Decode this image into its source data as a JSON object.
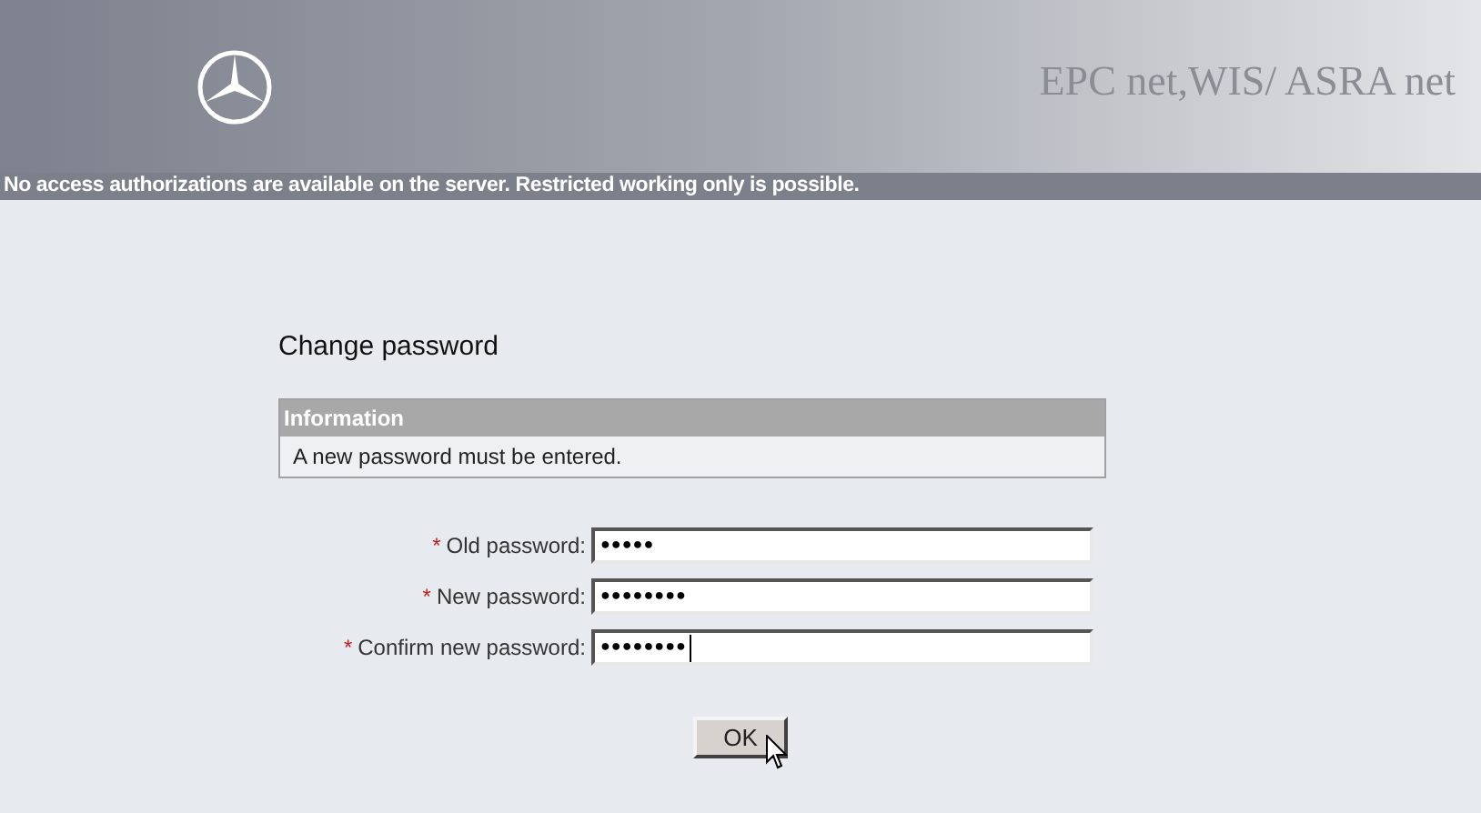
{
  "header": {
    "title": "EPC net,WIS/ ASRA net"
  },
  "notice": "No access authorizations are available on the server. Restricted working only is possible.",
  "form": {
    "title": "Change password",
    "info": {
      "heading": "Information",
      "message": "A new password must be entered."
    },
    "fields": [
      {
        "required_mark": "*",
        "label": "Old password:",
        "value": "●●●●●",
        "focused": false
      },
      {
        "required_mark": "*",
        "label": "New password:",
        "value": "●●●●●●●●",
        "focused": false
      },
      {
        "required_mark": "*",
        "label": "Confirm new password:",
        "value": "●●●●●●●●",
        "focused": true
      }
    ],
    "button": "OK"
  }
}
